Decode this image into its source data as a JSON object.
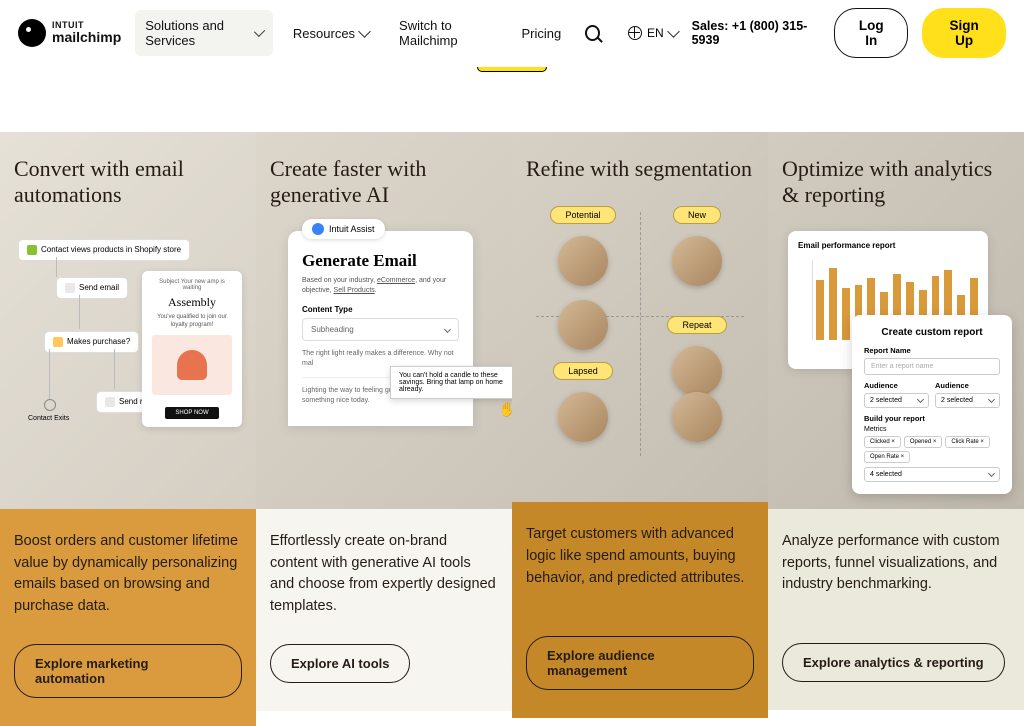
{
  "header": {
    "logo_line1": "INTUIT",
    "logo_line2": "mailchimp",
    "nav": {
      "solutions": "Solutions and Services",
      "resources": "Resources",
      "switch": "Switch to Mailchimp",
      "pricing": "Pricing"
    },
    "lang": "EN",
    "sales": "Sales: +1 (800) 315-5939",
    "login": "Log In",
    "signup": "Sign Up"
  },
  "columns": [
    {
      "title": "Convert with email automations",
      "desc": "Boost orders and customer lifetime value by dynamically personalizing emails based on browsing and purchase data.",
      "cta": "Explore marketing automation"
    },
    {
      "title": "Create faster with generative AI",
      "desc": "Effortlessly create on-brand content with generative AI tools and choose from expertly designed templates.",
      "cta": "Explore AI tools"
    },
    {
      "title": "Refine with segmentation",
      "desc": "Target customers with advanced logic like spend amounts, buying behavior, and predicted attributes.",
      "cta": "Explore audience management"
    },
    {
      "title": "Optimize with analytics & reporting",
      "desc": "Analyze performance with custom reports, funnel visualizations, and industry benchmarking.",
      "cta": "Explore analytics & reporting"
    }
  ],
  "illus1": {
    "n1": "Contact views products in Shopify store",
    "n2": "Send email",
    "n3": "Makes purchase?",
    "n4": "Send reminder",
    "exit": "Contact Exits",
    "card_sub": "Subject Your new amp is waiting",
    "card_title": "Assembly",
    "card_desc": "You've qualified to join our loyalty program!",
    "shop": "SHOP NOW"
  },
  "illus2": {
    "badge": "Intuit Assist",
    "title": "Generate Email",
    "meta1": "Based on your industry, ",
    "meta_u": "eCommerce",
    "meta2": ", and your objective, ",
    "meta_u2": "Sell Products",
    "content_type": "Content Type",
    "subheading": "Subheading",
    "gen1": "The right light really makes a difference. Why not mal",
    "tip1": "You can't hold a candle to these savings. Bring that lamp on home already.",
    "gen2": "Lighting the way to feeling good. Treat yourself to something nice today."
  },
  "illus3": {
    "potential": "Potential",
    "new": "New",
    "repeat": "Repeat",
    "lapsed": "Lapsed"
  },
  "illus4": {
    "report_title": "Email performance report",
    "custom_title": "Create custom report",
    "report_name_lbl": "Report Name",
    "report_name_ph": "Enter a report name",
    "audience": "Audience",
    "selected2": "2 selected",
    "build": "Build your report",
    "metrics": "Metrics",
    "chips": [
      "Clicked ×",
      "Opened ×",
      "Click Rate ×",
      "Open Rate ×"
    ],
    "sel4": "4 selected"
  },
  "chart_data": {
    "type": "bar",
    "values": [
      60,
      72,
      52,
      55,
      62,
      48,
      66,
      58,
      50,
      64,
      70,
      45,
      62
    ]
  }
}
